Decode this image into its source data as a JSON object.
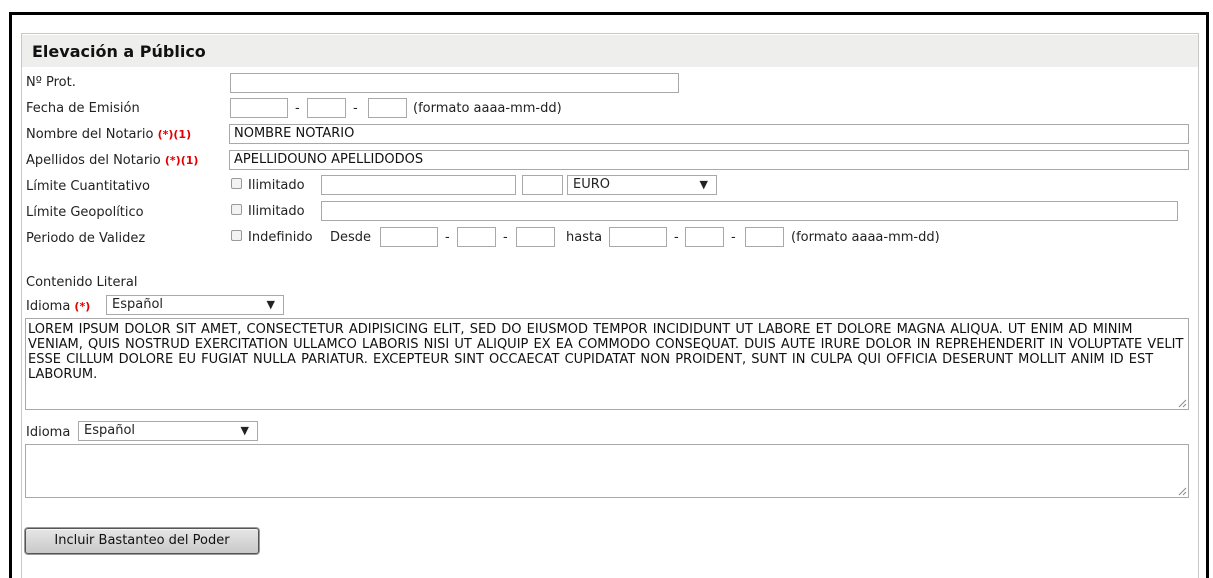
{
  "section_title": "Elevación a Público",
  "fields": {
    "nprot_label": "Nº Prot.",
    "nprot_value": "",
    "fecha_label": "Fecha de Emisión",
    "date_format_hint": "(formato aaaa-mm-dd)",
    "date_sep": "-",
    "nombre_label": "Nombre del Notario",
    "apellidos_label": "Apellidos del Notario",
    "required_mark": "(*)",
    "footnote_mark": "(1)",
    "nombre_value": "NOMBRE NOTARIO",
    "apellidos_value": "APELLIDOUNO APELLIDODOS",
    "limite_cuant_label": "Límite Cuantitativo",
    "limite_geo_label": "Límite Geopolítico",
    "ilimitado_label": "Ilimitado",
    "currency_value": "EURO",
    "periodo_label": "Periodo de Validez",
    "indefinido_label": "Indefinido",
    "desde_label": "Desde",
    "hasta_label": "hasta"
  },
  "contenido": {
    "title": "Contenido Literal",
    "idioma_label": "Idioma",
    "idioma1_value": "Español",
    "text1": "LOREM IPSUM DOLOR SIT AMET, CONSECTETUR ADIPISICING ELIT, SED DO EIUSMOD TEMPOR INCIDIDUNT UT LABORE ET DOLORE MAGNA ALIQUA. UT ENIM AD MINIM VENIAM, QUIS NOSTRUD EXERCITATION ULLAMCO LABORIS NISI UT ALIQUIP EX EA COMMODO CONSEQUAT. DUIS AUTE IRURE DOLOR IN REPREHENDERIT IN VOLUPTATE VELIT ESSE CILLUM DOLORE EU FUGIAT NULLA PARIATUR. EXCEPTEUR SINT OCCAECAT CUPIDATAT NON PROIDENT, SUNT IN CULPA QUI OFFICIA DESERUNT MOLLIT ANIM ID EST LABORUM.",
    "idioma2_value": "Español",
    "text2": ""
  },
  "button_label": "Incluir Bastanteo del Poder",
  "icons": {
    "dropdown_arrow": "▼"
  },
  "colors": {
    "required": "#e00000",
    "header_bg": "#eeeeec"
  }
}
